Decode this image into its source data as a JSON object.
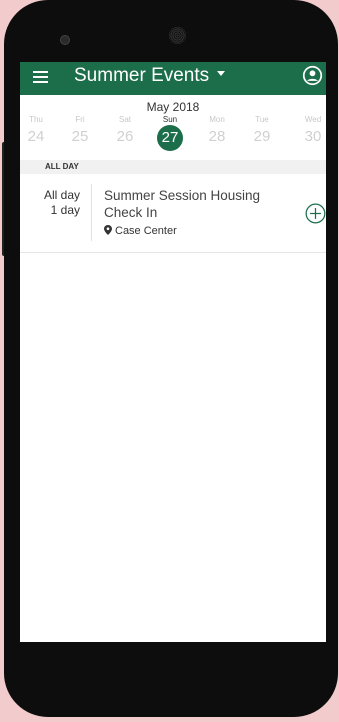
{
  "app": {
    "title": "Summer Events"
  },
  "calendar": {
    "month": "May 2018",
    "days": [
      {
        "name": "Thu",
        "num": "24"
      },
      {
        "name": "Fri",
        "num": "25"
      },
      {
        "name": "Sat",
        "num": "26"
      },
      {
        "name": "Sun",
        "num": "27"
      },
      {
        "name": "Mon",
        "num": "28"
      },
      {
        "name": "Tue",
        "num": "29"
      },
      {
        "name": "Wed",
        "num": "30"
      }
    ],
    "selected_day": "27"
  },
  "section": {
    "label": "ALL DAY"
  },
  "event": {
    "time_line1": "All day",
    "time_line2": "1 day",
    "title": "Summer Session Housing Check In",
    "location": "Case Center"
  },
  "colors": {
    "accent": "#1c6e4b",
    "background": "#f2cccc"
  },
  "icons": {
    "menu": "menu-icon",
    "account": "account-circle-icon",
    "location": "map-pin-icon",
    "add": "add-circle-icon"
  }
}
